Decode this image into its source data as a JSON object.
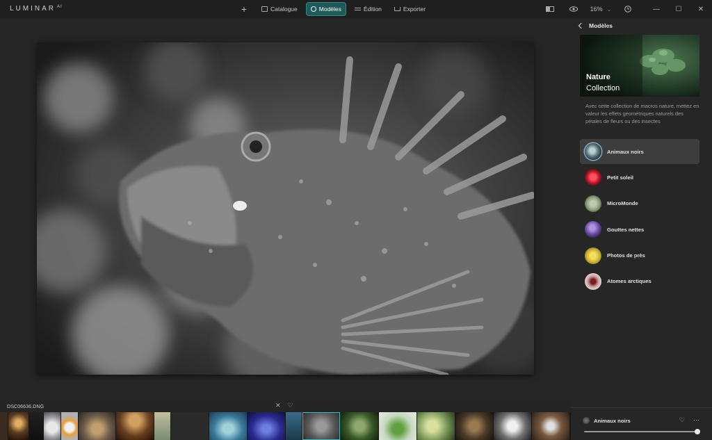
{
  "app": {
    "logo": "LUMINAR",
    "logo_sup": "AI"
  },
  "nav": {
    "add": "+",
    "items": [
      {
        "label": "Catalogue",
        "icon": "folder-icon"
      },
      {
        "label": "Modèles",
        "icon": "templates-icon",
        "active": true
      },
      {
        "label": "Édition",
        "icon": "sliders-icon"
      },
      {
        "label": "Exporter",
        "icon": "export-icon"
      }
    ]
  },
  "toolbar": {
    "zoom": "16%",
    "zoom_caret": "⌄",
    "window_minimize": "—",
    "window_maximize": "☐",
    "window_close": "✕"
  },
  "panel": {
    "back_label": "Modèles",
    "collection": {
      "title": "Nature",
      "subtitle": "Collection"
    },
    "description": "Avec cette collection de macros nature, mettez en valeur les effets géométriques naturels des pétales de fleurs ou des insectes",
    "presets": [
      {
        "label": "Animaux noirs",
        "selected": true,
        "color": "#6e8a8c"
      },
      {
        "label": "Petit soleil",
        "color": "#c01828"
      },
      {
        "label": "MicroMonde",
        "color": "#8a9a7a"
      },
      {
        "label": "Gouttes nettes",
        "color": "#6a4aa0"
      },
      {
        "label": "Photos de près",
        "color": "#d0b030"
      },
      {
        "label": "Atomes arctiques",
        "color": "#c9a0a0"
      }
    ]
  },
  "filmbar": {
    "filename": "DSC06636.DNG",
    "reject_icon": "✕",
    "favorite_icon": "♡"
  },
  "applied": {
    "label": "Animaux noirs",
    "amount": 100,
    "favorite_icon": "♡",
    "more_icon": "···"
  }
}
